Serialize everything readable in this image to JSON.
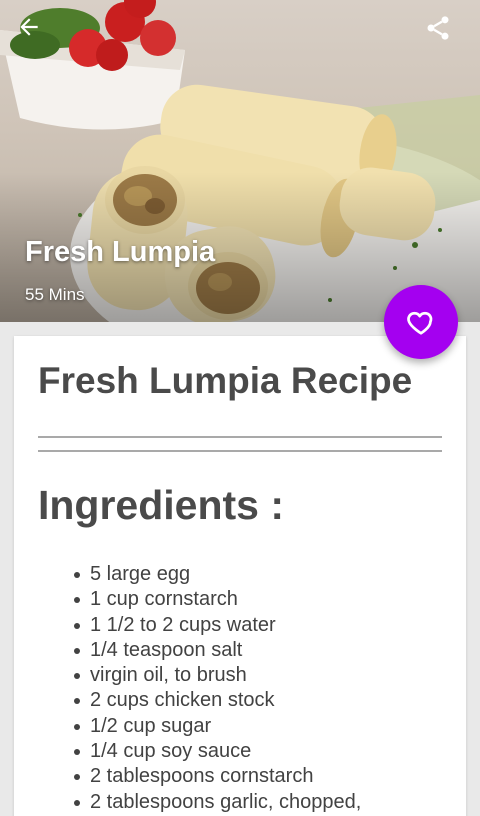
{
  "header": {
    "title": "Fresh Lumpia",
    "duration": "55 Mins",
    "back_icon": "arrow-left-icon",
    "share_icon": "share-icon"
  },
  "favorite": {
    "icon": "heart-outline-icon",
    "color": "#a400f0"
  },
  "recipe": {
    "title": "Fresh Lumpia Recipe",
    "ingredients_heading": "Ingredients :",
    "ingredients": [
      "5 large egg",
      "1 cup cornstarch",
      "1 1/2 to 2 cups water",
      "1/4 teaspoon salt",
      "virgin oil, to brush",
      "2 cups chicken stock",
      "1/2 cup sugar",
      "1/4 cup soy sauce",
      "2 tablespoons cornstarch",
      "2 tablespoons garlic, chopped,"
    ]
  }
}
